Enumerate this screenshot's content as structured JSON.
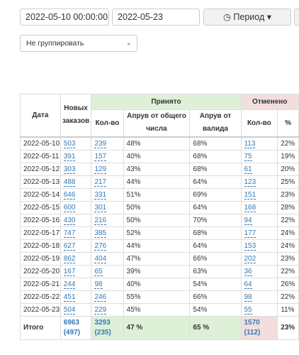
{
  "filters": {
    "date_from": "2022-05-10 00:00:00",
    "date_to": "2022-05-23",
    "period_label": "Период",
    "group_by": "Не группировать"
  },
  "table": {
    "headers": {
      "date": "Дата",
      "new_orders": "Новых заказов",
      "accepted": "Принято",
      "canceled": "Отменено",
      "acc_count": "Кол-во",
      "acc_approve_total": "Апрув от общего числа",
      "acc_approve_valid": "Апрув от валида",
      "can_count": "Кол-во",
      "can_pct": "%"
    },
    "rows": [
      {
        "date": "2022-05-10",
        "new": "503",
        "acc": "239",
        "ap_total": "48%",
        "ap_valid": "68%",
        "can": "113",
        "pct": "22%"
      },
      {
        "date": "2022-05-11",
        "new": "391",
        "acc": "157",
        "ap_total": "40%",
        "ap_valid": "68%",
        "can": "75",
        "pct": "19%"
      },
      {
        "date": "2022-05-12",
        "new": "303",
        "acc": "129",
        "ap_total": "43%",
        "ap_valid": "68%",
        "can": "61",
        "pct": "20%"
      },
      {
        "date": "2022-05-13",
        "new": "488",
        "acc": "217",
        "ap_total": "44%",
        "ap_valid": "64%",
        "can": "123",
        "pct": "25%"
      },
      {
        "date": "2022-05-14",
        "new": "646",
        "acc": "331",
        "ap_total": "51%",
        "ap_valid": "69%",
        "can": "151",
        "pct": "23%"
      },
      {
        "date": "2022-05-15",
        "new": "600",
        "acc": "301",
        "ap_total": "50%",
        "ap_valid": "64%",
        "can": "168",
        "pct": "28%"
      },
      {
        "date": "2022-05-16",
        "new": "430",
        "acc": "216",
        "ap_total": "50%",
        "ap_valid": "70%",
        "can": "94",
        "pct": "22%"
      },
      {
        "date": "2022-05-17",
        "new": "747",
        "acc": "385",
        "ap_total": "52%",
        "ap_valid": "68%",
        "can": "177",
        "pct": "24%"
      },
      {
        "date": "2022-05-18",
        "new": "627",
        "acc": "276",
        "ap_total": "44%",
        "ap_valid": "64%",
        "can": "153",
        "pct": "24%"
      },
      {
        "date": "2022-05-19",
        "new": "862",
        "acc": "404",
        "ap_total": "47%",
        "ap_valid": "66%",
        "can": "202",
        "pct": "23%"
      },
      {
        "date": "2022-05-20",
        "new": "167",
        "acc": "65",
        "ap_total": "39%",
        "ap_valid": "63%",
        "can": "36",
        "pct": "22%"
      },
      {
        "date": "2022-05-21",
        "new": "244",
        "acc": "98",
        "ap_total": "40%",
        "ap_valid": "54%",
        "can": "64",
        "pct": "26%"
      },
      {
        "date": "2022-05-22",
        "new": "451",
        "acc": "246",
        "ap_total": "55%",
        "ap_valid": "66%",
        "can": "98",
        "pct": "22%"
      },
      {
        "date": "2022-05-23",
        "new": "504",
        "acc": "229",
        "ap_total": "45%",
        "ap_valid": "54%",
        "can": "55",
        "pct": "11%"
      }
    ],
    "footer": {
      "label": "Итого",
      "new": "6963",
      "new_sub": "(497)",
      "acc": "3293",
      "acc_sub": "(235)",
      "ap_total": "47 %",
      "ap_valid": "65 %",
      "can": "1570",
      "can_sub": "(112)",
      "pct": "23%"
    }
  },
  "colors": {
    "accepted_bg": "#dff0d8",
    "canceled_bg": "#f2dede",
    "link": "#337ab7"
  },
  "icons": {
    "period": "clock-icon",
    "dropdown": "caret-down-icon",
    "select": "chevron-down-icon"
  }
}
